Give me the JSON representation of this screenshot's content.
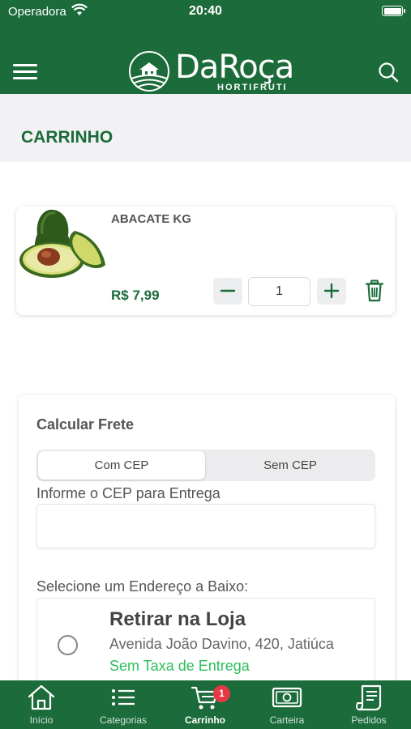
{
  "status_bar": {
    "carrier": "Operadora",
    "time": "20:40"
  },
  "header": {
    "brand": "DaRoça",
    "brand_sub": "HORTIFRUTI"
  },
  "page": {
    "title": "CARRINHO"
  },
  "cart": {
    "items": [
      {
        "name": "ABACATE KG",
        "price": "R$ 7,99",
        "quantity": "1",
        "image": "avocado-image"
      }
    ]
  },
  "shipping": {
    "title": "Calcular Frete",
    "tabs": [
      "Com CEP",
      "Sem CEP"
    ],
    "selected_tab": "Com CEP",
    "cep_label": "Informe o CEP para Entrega",
    "cep_value": "",
    "address_label": "Selecione um Endereço a Baixo:",
    "addresses": [
      {
        "name": "Retirar na Loja",
        "street": "Avenida João Davino, 420, Jatiúca",
        "fee": "Sem Taxa de Entrega",
        "selected": false
      }
    ]
  },
  "tabbar": {
    "tabs": [
      {
        "label": "Início",
        "icon": "home-icon"
      },
      {
        "label": "Categorias",
        "icon": "list-icon"
      },
      {
        "label": "Carrinho",
        "icon": "cart-icon",
        "active": true,
        "badge": "1"
      },
      {
        "label": "Carteira",
        "icon": "wallet-icon"
      },
      {
        "label": "Pedidos",
        "icon": "receipt-icon"
      }
    ]
  },
  "colors": {
    "brand_green": "#1c6b3a",
    "accent_green": "#2dbe5c",
    "badge_red": "#e63946"
  }
}
